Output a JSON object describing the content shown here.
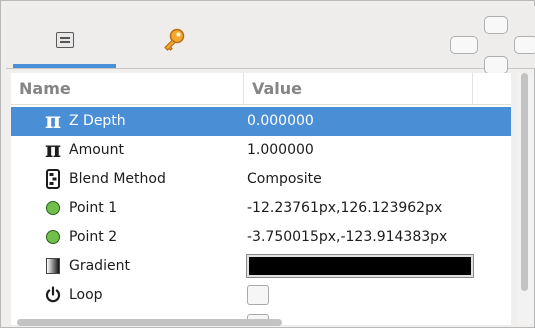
{
  "tabs": [
    {
      "icon": "params-panel-icon",
      "selected": true
    },
    {
      "icon": "key-icon",
      "selected": false
    }
  ],
  "columns": {
    "name": "Name",
    "value": "Value"
  },
  "rows": [
    {
      "icon": "pi-icon",
      "name": "Z Depth",
      "value": "0.000000",
      "selected": true
    },
    {
      "icon": "pi-icon",
      "name": "Amount",
      "value": "1.000000"
    },
    {
      "icon": "blend-method-icon",
      "name": "Blend Method",
      "value": "Composite"
    },
    {
      "icon": "point-icon",
      "name": "Point 1",
      "value": "-12.23761px,126.123962px"
    },
    {
      "icon": "point-icon",
      "name": "Point 2",
      "value": "-3.750015px,-123.914383px"
    },
    {
      "icon": "gradient-icon",
      "name": "Gradient",
      "value_color": "#000000"
    },
    {
      "icon": "power-icon",
      "name": "Loop",
      "checked": false
    }
  ],
  "colors": {
    "selection": "#4a8ed6",
    "accent": "#4a90d9",
    "point": "#6fbf4a"
  }
}
